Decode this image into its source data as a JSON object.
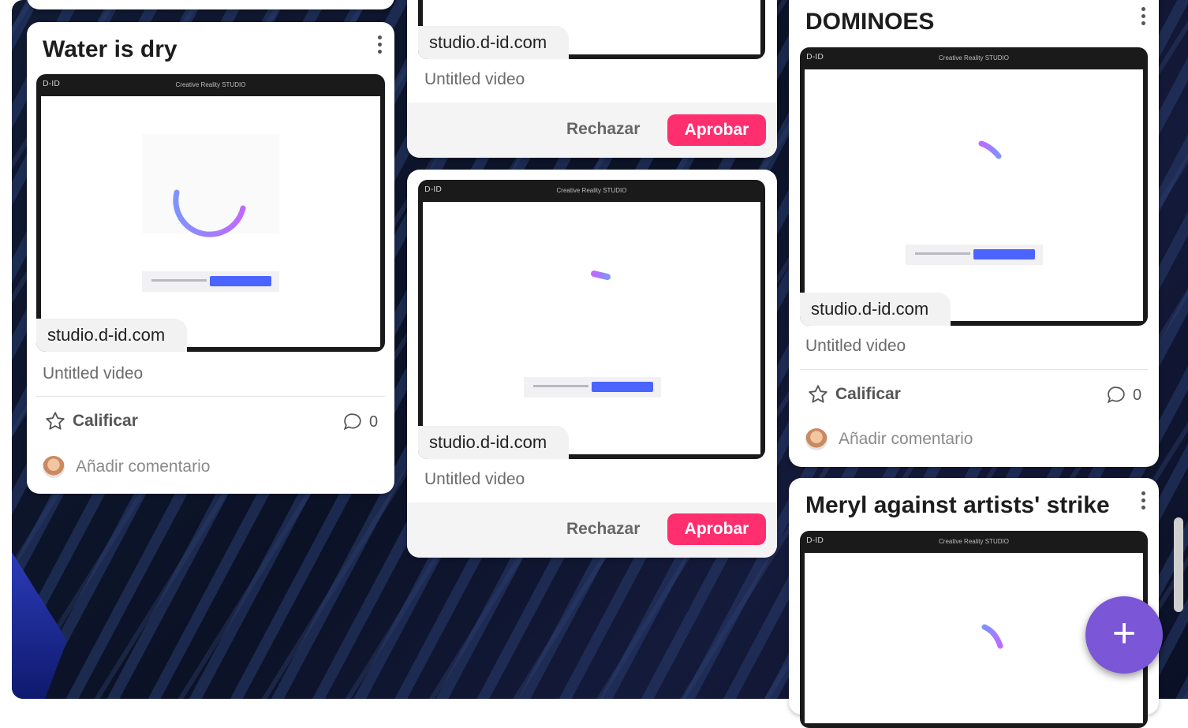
{
  "colors": {
    "approve": "#ff2f6f",
    "fab": "#7b56d6",
    "spinner_start": "#7f93ff",
    "spinner_end": "#c069ff"
  },
  "preview": {
    "logo": "D-ID",
    "header": "Creative Reality STUDIO"
  },
  "cards": {
    "water": {
      "title": "Water is dry",
      "domain": "studio.d-id.com",
      "video_title": "Untitled video",
      "rate_label": "Calificar",
      "comment_count": "0",
      "add_comment": "Añadir comentario"
    },
    "top_mid": {
      "domain": "studio.d-id.com",
      "video_title": "Untitled video",
      "reject_label": "Rechazar",
      "approve_label": "Aprobar"
    },
    "mid": {
      "domain": "studio.d-id.com",
      "video_title": "Untitled video",
      "reject_label": "Rechazar",
      "approve_label": "Aprobar"
    },
    "dominoes": {
      "title": "DOMINOES",
      "domain": "studio.d-id.com",
      "video_title": "Untitled video",
      "rate_label": "Calificar",
      "comment_count": "0",
      "add_comment": "Añadir comentario"
    },
    "meryl": {
      "title": "Meryl against artists' strike"
    }
  },
  "fab": {
    "icon": "plus-icon",
    "label": "+"
  }
}
